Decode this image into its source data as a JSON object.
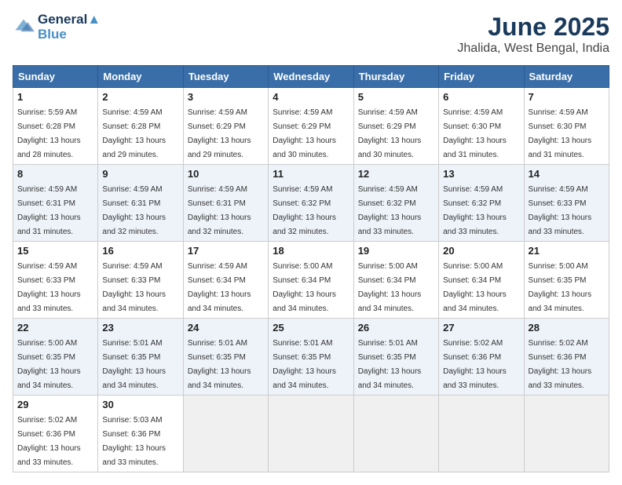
{
  "header": {
    "logo_line1": "General",
    "logo_line2": "Blue",
    "month": "June 2025",
    "location": "Jhalida, West Bengal, India"
  },
  "weekdays": [
    "Sunday",
    "Monday",
    "Tuesday",
    "Wednesday",
    "Thursday",
    "Friday",
    "Saturday"
  ],
  "weeks": [
    [
      {
        "day": "1",
        "sunrise": "5:59 AM",
        "sunset": "6:28 PM",
        "daylight": "13 hours and 28 minutes."
      },
      {
        "day": "2",
        "sunrise": "4:59 AM",
        "sunset": "6:28 PM",
        "daylight": "13 hours and 29 minutes."
      },
      {
        "day": "3",
        "sunrise": "4:59 AM",
        "sunset": "6:29 PM",
        "daylight": "13 hours and 29 minutes."
      },
      {
        "day": "4",
        "sunrise": "4:59 AM",
        "sunset": "6:29 PM",
        "daylight": "13 hours and 30 minutes."
      },
      {
        "day": "5",
        "sunrise": "4:59 AM",
        "sunset": "6:29 PM",
        "daylight": "13 hours and 30 minutes."
      },
      {
        "day": "6",
        "sunrise": "4:59 AM",
        "sunset": "6:30 PM",
        "daylight": "13 hours and 31 minutes."
      },
      {
        "day": "7",
        "sunrise": "4:59 AM",
        "sunset": "6:30 PM",
        "daylight": "13 hours and 31 minutes."
      }
    ],
    [
      {
        "day": "8",
        "sunrise": "4:59 AM",
        "sunset": "6:31 PM",
        "daylight": "13 hours and 31 minutes."
      },
      {
        "day": "9",
        "sunrise": "4:59 AM",
        "sunset": "6:31 PM",
        "daylight": "13 hours and 32 minutes."
      },
      {
        "day": "10",
        "sunrise": "4:59 AM",
        "sunset": "6:31 PM",
        "daylight": "13 hours and 32 minutes."
      },
      {
        "day": "11",
        "sunrise": "4:59 AM",
        "sunset": "6:32 PM",
        "daylight": "13 hours and 32 minutes."
      },
      {
        "day": "12",
        "sunrise": "4:59 AM",
        "sunset": "6:32 PM",
        "daylight": "13 hours and 33 minutes."
      },
      {
        "day": "13",
        "sunrise": "4:59 AM",
        "sunset": "6:32 PM",
        "daylight": "13 hours and 33 minutes."
      },
      {
        "day": "14",
        "sunrise": "4:59 AM",
        "sunset": "6:33 PM",
        "daylight": "13 hours and 33 minutes."
      }
    ],
    [
      {
        "day": "15",
        "sunrise": "4:59 AM",
        "sunset": "6:33 PM",
        "daylight": "13 hours and 33 minutes."
      },
      {
        "day": "16",
        "sunrise": "4:59 AM",
        "sunset": "6:33 PM",
        "daylight": "13 hours and 34 minutes."
      },
      {
        "day": "17",
        "sunrise": "4:59 AM",
        "sunset": "6:34 PM",
        "daylight": "13 hours and 34 minutes."
      },
      {
        "day": "18",
        "sunrise": "5:00 AM",
        "sunset": "6:34 PM",
        "daylight": "13 hours and 34 minutes."
      },
      {
        "day": "19",
        "sunrise": "5:00 AM",
        "sunset": "6:34 PM",
        "daylight": "13 hours and 34 minutes."
      },
      {
        "day": "20",
        "sunrise": "5:00 AM",
        "sunset": "6:34 PM",
        "daylight": "13 hours and 34 minutes."
      },
      {
        "day": "21",
        "sunrise": "5:00 AM",
        "sunset": "6:35 PM",
        "daylight": "13 hours and 34 minutes."
      }
    ],
    [
      {
        "day": "22",
        "sunrise": "5:00 AM",
        "sunset": "6:35 PM",
        "daylight": "13 hours and 34 minutes."
      },
      {
        "day": "23",
        "sunrise": "5:01 AM",
        "sunset": "6:35 PM",
        "daylight": "13 hours and 34 minutes."
      },
      {
        "day": "24",
        "sunrise": "5:01 AM",
        "sunset": "6:35 PM",
        "daylight": "13 hours and 34 minutes."
      },
      {
        "day": "25",
        "sunrise": "5:01 AM",
        "sunset": "6:35 PM",
        "daylight": "13 hours and 34 minutes."
      },
      {
        "day": "26",
        "sunrise": "5:01 AM",
        "sunset": "6:35 PM",
        "daylight": "13 hours and 34 minutes."
      },
      {
        "day": "27",
        "sunrise": "5:02 AM",
        "sunset": "6:36 PM",
        "daylight": "13 hours and 33 minutes."
      },
      {
        "day": "28",
        "sunrise": "5:02 AM",
        "sunset": "6:36 PM",
        "daylight": "13 hours and 33 minutes."
      }
    ],
    [
      {
        "day": "29",
        "sunrise": "5:02 AM",
        "sunset": "6:36 PM",
        "daylight": "13 hours and 33 minutes."
      },
      {
        "day": "30",
        "sunrise": "5:03 AM",
        "sunset": "6:36 PM",
        "daylight": "13 hours and 33 minutes."
      },
      null,
      null,
      null,
      null,
      null
    ]
  ]
}
